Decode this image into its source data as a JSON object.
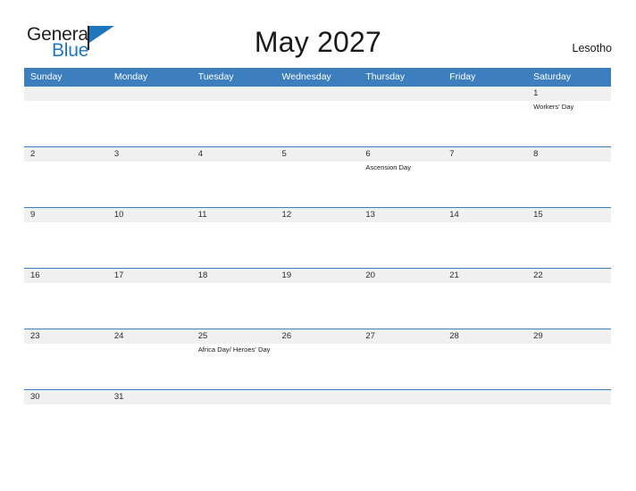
{
  "brand": {
    "name_part1": "General",
    "name_part2": "Blue",
    "primary_color": "#1e76bd",
    "flag_icon": "flag-icon"
  },
  "header": {
    "title": "May 2027",
    "country": "Lesotho"
  },
  "calendar": {
    "header_bg": "#3c7ebe",
    "date_band_bg": "#f0f0f0",
    "day_names": [
      "Sunday",
      "Monday",
      "Tuesday",
      "Wednesday",
      "Thursday",
      "Friday",
      "Saturday"
    ],
    "weeks": [
      {
        "days": [
          {
            "date": "",
            "events": []
          },
          {
            "date": "",
            "events": []
          },
          {
            "date": "",
            "events": []
          },
          {
            "date": "",
            "events": []
          },
          {
            "date": "",
            "events": []
          },
          {
            "date": "",
            "events": []
          },
          {
            "date": "1",
            "events": [
              "Workers' Day"
            ]
          }
        ]
      },
      {
        "days": [
          {
            "date": "2",
            "events": []
          },
          {
            "date": "3",
            "events": []
          },
          {
            "date": "4",
            "events": []
          },
          {
            "date": "5",
            "events": []
          },
          {
            "date": "6",
            "events": [
              "Ascension Day"
            ]
          },
          {
            "date": "7",
            "events": []
          },
          {
            "date": "8",
            "events": []
          }
        ]
      },
      {
        "days": [
          {
            "date": "9",
            "events": []
          },
          {
            "date": "10",
            "events": []
          },
          {
            "date": "11",
            "events": []
          },
          {
            "date": "12",
            "events": []
          },
          {
            "date": "13",
            "events": []
          },
          {
            "date": "14",
            "events": []
          },
          {
            "date": "15",
            "events": []
          }
        ]
      },
      {
        "days": [
          {
            "date": "16",
            "events": []
          },
          {
            "date": "17",
            "events": []
          },
          {
            "date": "18",
            "events": []
          },
          {
            "date": "19",
            "events": []
          },
          {
            "date": "20",
            "events": []
          },
          {
            "date": "21",
            "events": []
          },
          {
            "date": "22",
            "events": []
          }
        ]
      },
      {
        "days": [
          {
            "date": "23",
            "events": []
          },
          {
            "date": "24",
            "events": []
          },
          {
            "date": "25",
            "events": [
              "Africa Day/ Heroes' Day"
            ]
          },
          {
            "date": "26",
            "events": []
          },
          {
            "date": "27",
            "events": []
          },
          {
            "date": "28",
            "events": []
          },
          {
            "date": "29",
            "events": []
          }
        ]
      },
      {
        "days": [
          {
            "date": "30",
            "events": []
          },
          {
            "date": "31",
            "events": []
          },
          {
            "date": "",
            "events": []
          },
          {
            "date": "",
            "events": []
          },
          {
            "date": "",
            "events": []
          },
          {
            "date": "",
            "events": []
          },
          {
            "date": "",
            "events": []
          }
        ]
      }
    ]
  }
}
